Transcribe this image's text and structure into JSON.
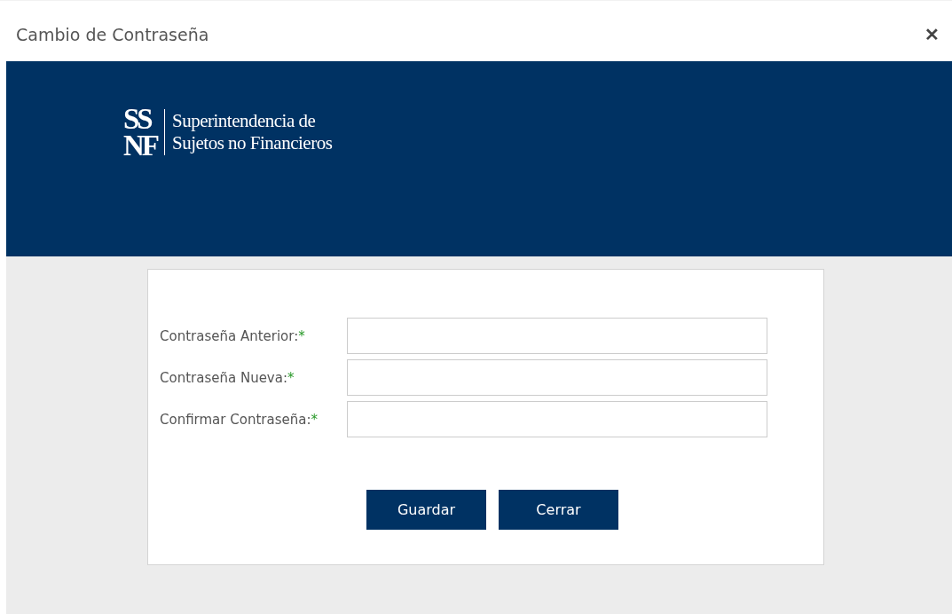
{
  "dialog": {
    "title": "Cambio de Contraseña",
    "close": "✕"
  },
  "banner": {
    "logo_mark": [
      "SS",
      "NF"
    ],
    "logo_text": [
      "Superintendencia de",
      "Sujetos no Financieros"
    ]
  },
  "form": {
    "fields": [
      {
        "label": "Contraseña Anterior:",
        "required_mark": "*"
      },
      {
        "label": "Contraseña Nueva:",
        "required_mark": "*"
      },
      {
        "label": "Confirmar Contraseña:",
        "required_mark": "*"
      }
    ],
    "buttons": [
      "Guardar",
      "Cerrar"
    ]
  }
}
